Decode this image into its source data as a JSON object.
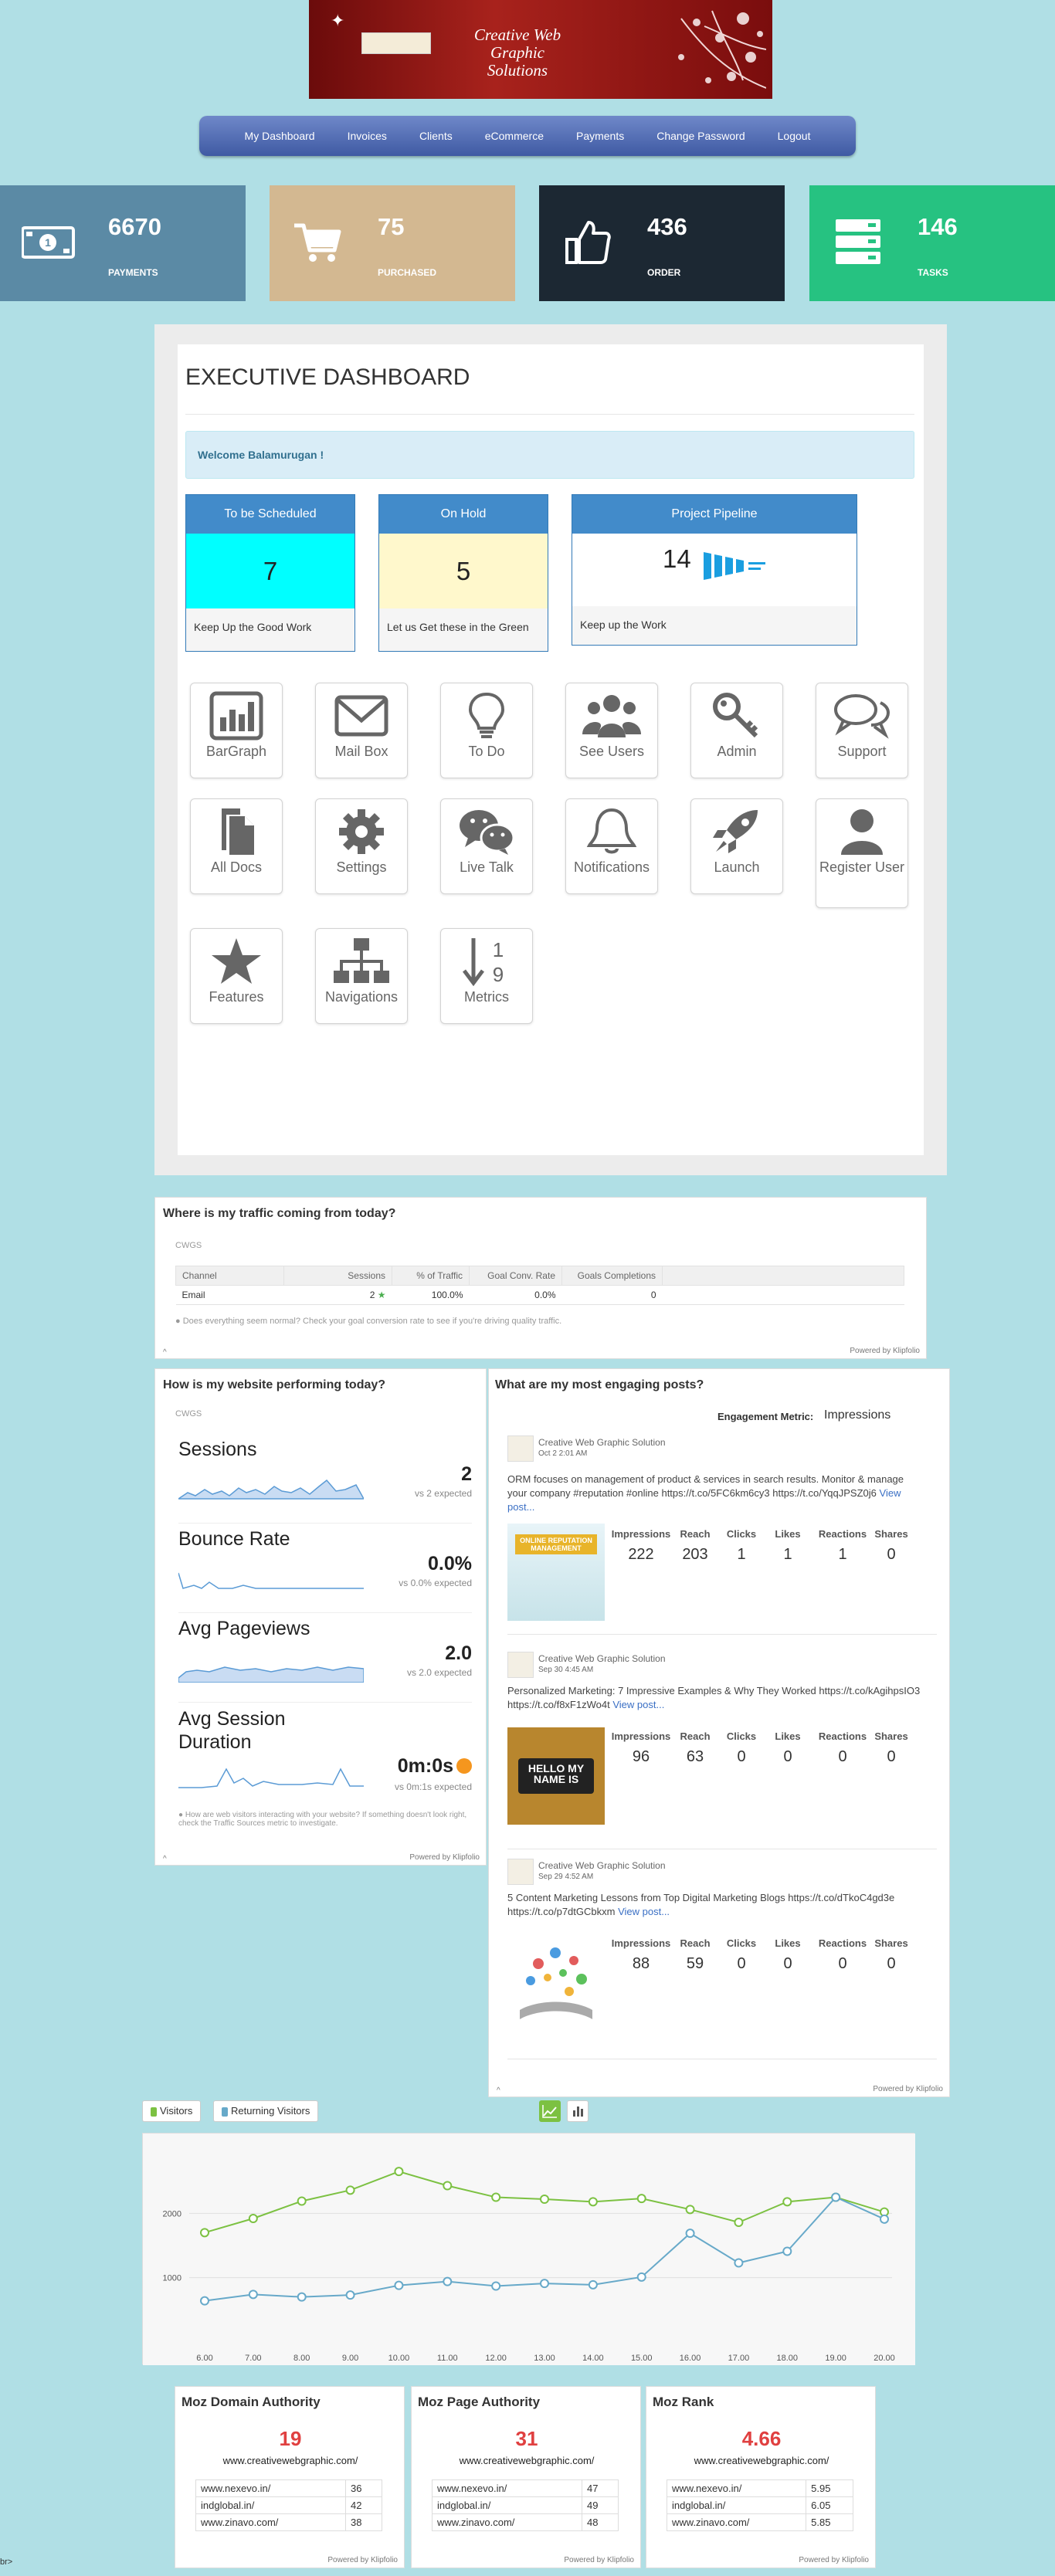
{
  "banner": {
    "title": "Creative Web Graphic Solutions"
  },
  "nav": {
    "items": [
      "My Dashboard",
      "Invoices",
      "Clients",
      "eCommerce",
      "Payments",
      "Change Password",
      "Logout"
    ]
  },
  "stats": [
    {
      "value": "6670",
      "label": "PAYMENTS",
      "color": "#5b8aa5",
      "icon": "money-icon"
    },
    {
      "value": "75",
      "label": "PURCHASED",
      "color": "#d3b891",
      "icon": "cart-icon"
    },
    {
      "value": "436",
      "label": "ORDER",
      "color": "#1c2833",
      "icon": "thumbs-up-icon"
    },
    {
      "value": "146",
      "label": "TASKS",
      "color": "#26c281",
      "icon": "server-icon"
    }
  ],
  "dashboard": {
    "title": "EXECUTIVE DASHBOARD",
    "welcome": "Welcome Balamurugan !",
    "boxes": [
      {
        "head": "To be Scheduled",
        "value": "7",
        "foot": "Keep Up the Good Work",
        "bg": "#00ffff"
      },
      {
        "head": "On Hold",
        "value": "5",
        "foot": "Let us Get these in the Green",
        "bg": "#fff8cc"
      },
      {
        "head": "Project Pipeline",
        "value": "14",
        "foot": "Keep up the Work",
        "bg": "#ffffff"
      }
    ],
    "tiles": [
      {
        "label": "BarGraph",
        "icon": "bar-graph-icon"
      },
      {
        "label": "Mail Box",
        "icon": "mail-icon"
      },
      {
        "label": "To Do",
        "icon": "lightbulb-icon"
      },
      {
        "label": "See Users",
        "icon": "users-icon"
      },
      {
        "label": "Admin",
        "icon": "key-icon"
      },
      {
        "label": "Support",
        "icon": "chat-icon"
      },
      {
        "label": "All Docs",
        "icon": "docs-icon"
      },
      {
        "label": "Settings",
        "icon": "gear-icon"
      },
      {
        "label": "Live Talk",
        "icon": "wechat-icon"
      },
      {
        "label": "Notifications",
        "icon": "bell-icon"
      },
      {
        "label": "Launch",
        "icon": "rocket-icon"
      },
      {
        "label": "Register User",
        "icon": "user-icon"
      },
      {
        "label": "Features",
        "icon": "star-icon"
      },
      {
        "label": "Navigations",
        "icon": "sitemap-icon"
      },
      {
        "label": "Metrics",
        "icon": "sort-numeric-icon"
      }
    ]
  },
  "traffic": {
    "title": "Where is my traffic coming from today?",
    "site": "CWGS",
    "columns": [
      "Channel",
      "Sessions",
      "% of Traffic",
      "Goal Conv. Rate",
      "Goals Completions"
    ],
    "row": [
      "Email",
      "2",
      "100.0%",
      "0.0%",
      "0"
    ],
    "hint": "Does everything seem normal? Check your goal conversion rate to see if you're driving quality traffic.",
    "powered": "Powered by Klipfolio"
  },
  "performance": {
    "title": "How is my website performing today?",
    "site": "CWGS",
    "metrics": [
      {
        "name": "Sessions",
        "value": "2",
        "sub": "vs 2 expected"
      },
      {
        "name": "Bounce Rate",
        "value": "0.0%",
        "sub": "vs 0.0% expected"
      },
      {
        "name": "Avg Pageviews",
        "value": "2.0",
        "sub": "vs 2.0 expected"
      },
      {
        "name": "Avg Session Duration",
        "value": "0m:0s",
        "sub": "vs 0m:1s expected"
      }
    ],
    "hint": "How are web visitors interacting with your website? If something doesn't look right, check the Traffic Sources metric to investigate.",
    "powered": "Powered by Klipfolio"
  },
  "posts": {
    "title": "What are my most engaging posts?",
    "metric_label": "Engagement Metric:",
    "metric_value": "Impressions",
    "columns": [
      "Impressions",
      "Reach",
      "Clicks",
      "Likes",
      "Reactions",
      "Shares"
    ],
    "items": [
      {
        "author": "Creative Web Graphic Solution",
        "date": "Oct 2 2:01 AM",
        "text": "ORM focuses on management of product & services in search results. Monitor & manage your company #reputation #online https://t.co/5FC6km6cy3 https://t.co/YqqJPSZ0j6",
        "link": "View post...",
        "values": [
          "222",
          "203",
          "1",
          "1",
          "1",
          "0"
        ],
        "image_label": "ONLINE REPUTATION MANAGEMENT"
      },
      {
        "author": "Creative Web Graphic Solution",
        "date": "Sep 30 4:45 AM",
        "text": "Personalized Marketing: 7 Impressive Examples & Why They Worked https://t.co/kAgihpsIO3 https://t.co/f8xF1zWo4t",
        "link": "View post...",
        "values": [
          "96",
          "63",
          "0",
          "0",
          "0",
          "0"
        ],
        "image_label": "HELLO MY NAME IS"
      },
      {
        "author": "Creative Web Graphic Solution",
        "date": "Sep 29 4:52 AM",
        "text": "5 Content Marketing Lessons from Top Digital Marketing Blogs https://t.co/dTkoC4gd3e https://t.co/p7dtGCbkxm",
        "link": "View post...",
        "values": [
          "88",
          "59",
          "0",
          "0",
          "0",
          "0"
        ],
        "image_label": ""
      }
    ],
    "powered": "Powered by Klipfolio"
  },
  "visitors_chart": {
    "buttons": [
      "Visitors",
      "Returning Visitors"
    ]
  },
  "chart_data": {
    "type": "line",
    "x": [
      "6.00",
      "7.00",
      "8.00",
      "9.00",
      "10.00",
      "11.00",
      "12.00",
      "13.00",
      "14.00",
      "15.00",
      "16.00",
      "17.00",
      "18.00",
      "19.00",
      "20.00"
    ],
    "series": [
      {
        "name": "Visitors",
        "color": "#7cc142",
        "values": [
          1700,
          1920,
          2190,
          2360,
          2650,
          2430,
          2250,
          2220,
          2180,
          2230,
          2060,
          1860,
          2180,
          2250,
          2020
        ]
      },
      {
        "name": "Returning Visitors",
        "color": "#67a9c9",
        "values": [
          640,
          740,
          700,
          730,
          880,
          940,
          870,
          910,
          890,
          1010,
          1690,
          1230,
          1410,
          2250,
          1910
        ]
      }
    ],
    "yticks": [
      1000,
      2000
    ],
    "ylim": [
      0,
      3000
    ]
  },
  "moz": [
    {
      "title": "Moz Domain Authority",
      "value": "19",
      "url": "www.creativewebgraphic.com/",
      "rows": [
        [
          "www.nexevo.in/",
          "36"
        ],
        [
          "indglobal.in/",
          "42"
        ],
        [
          "www.zinavo.com/",
          "38"
        ]
      ]
    },
    {
      "title": "Moz Page Authority",
      "value": "31",
      "url": "www.creativewebgraphic.com/",
      "rows": [
        [
          "www.nexevo.in/",
          "47"
        ],
        [
          "indglobal.in/",
          "49"
        ],
        [
          "www.zinavo.com/",
          "48"
        ]
      ]
    },
    {
      "title": "Moz Rank",
      "value": "4.66",
      "url": "www.creativewebgraphic.com/",
      "rows": [
        [
          "www.nexevo.in/",
          "5.95"
        ],
        [
          "indglobal.in/",
          "6.05"
        ],
        [
          "www.zinavo.com/",
          "5.85"
        ]
      ]
    }
  ],
  "moz_powered": "Powered by Klipfolio",
  "footer_fragment": "br>"
}
